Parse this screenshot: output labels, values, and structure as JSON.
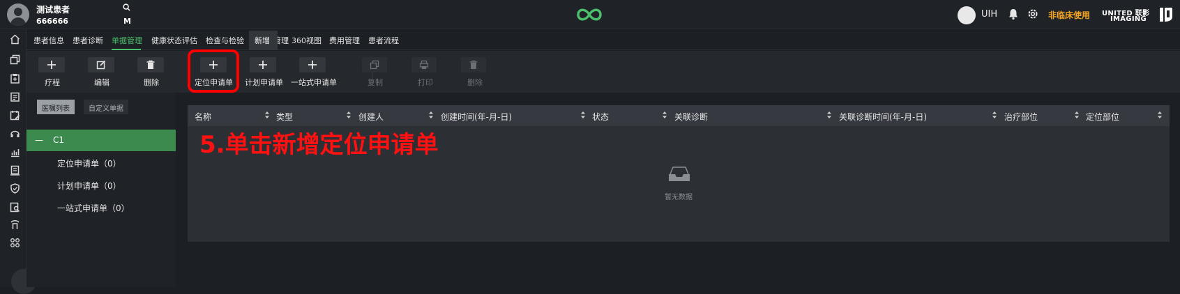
{
  "header": {
    "patient_name": "测试患者",
    "patient_id": "666666",
    "search_icon": "search-icon",
    "m_label": "M",
    "user": "UIH",
    "non_clinical": "非临床使用",
    "brand_line1": "UNITED 联影",
    "brand_line2": "IMAGING"
  },
  "rail": {
    "icons": [
      "home-icon",
      "copy-icon",
      "clipboard-add-icon",
      "calendar-icon",
      "calendar-edit-icon",
      "headset-icon",
      "chart-icon",
      "document-icon",
      "shield-icon",
      "search-doc-icon",
      "tower-icon",
      "command-icon"
    ]
  },
  "tabs": [
    "患者信息",
    "患者诊断",
    "单据管理",
    "健康状态评估",
    "检查与检验",
    "治疗管理",
    "360视图",
    "费用管理",
    "患者流程"
  ],
  "tab_active": "单据管理",
  "tab_popup": "新增",
  "toolbar": {
    "buttons": [
      {
        "label": "疗程",
        "icon": "plus-icon",
        "enabled": true
      },
      {
        "label": "编辑",
        "icon": "edit-icon",
        "enabled": true
      },
      {
        "label": "删除",
        "icon": "trash-icon",
        "enabled": true
      },
      {
        "label": "定位申请单",
        "icon": "plus-icon",
        "enabled": true
      },
      {
        "label": "计划申请单",
        "icon": "plus-icon",
        "enabled": true
      },
      {
        "label": "一站式申请单",
        "icon": "plus-icon",
        "enabled": true
      },
      {
        "label": "复制",
        "icon": "copy-icon",
        "enabled": false
      },
      {
        "label": "打印",
        "icon": "printer-icon",
        "enabled": false
      },
      {
        "label": "删除",
        "icon": "trash-icon",
        "enabled": false
      }
    ]
  },
  "left_panel": {
    "segments": [
      "医嘱列表",
      "自定义单据"
    ],
    "group_label": "C1",
    "items": [
      "定位申请单（0）",
      "计划申请单（0）",
      "一站式申请单（0）"
    ]
  },
  "table": {
    "columns": [
      "名称",
      "类型",
      "创建人",
      "创建时间(年-月-日)",
      "状态",
      "关联诊断",
      "关联诊断时间(年-月-日)",
      "治疗部位",
      "定位部位"
    ],
    "rows": [],
    "empty_text": "暂无数据"
  },
  "annotation": "5.单击新增定位申请单",
  "colors": {
    "accent": "#4cbf6c",
    "highlight": "#ff0000",
    "warning": "#f5a623"
  }
}
